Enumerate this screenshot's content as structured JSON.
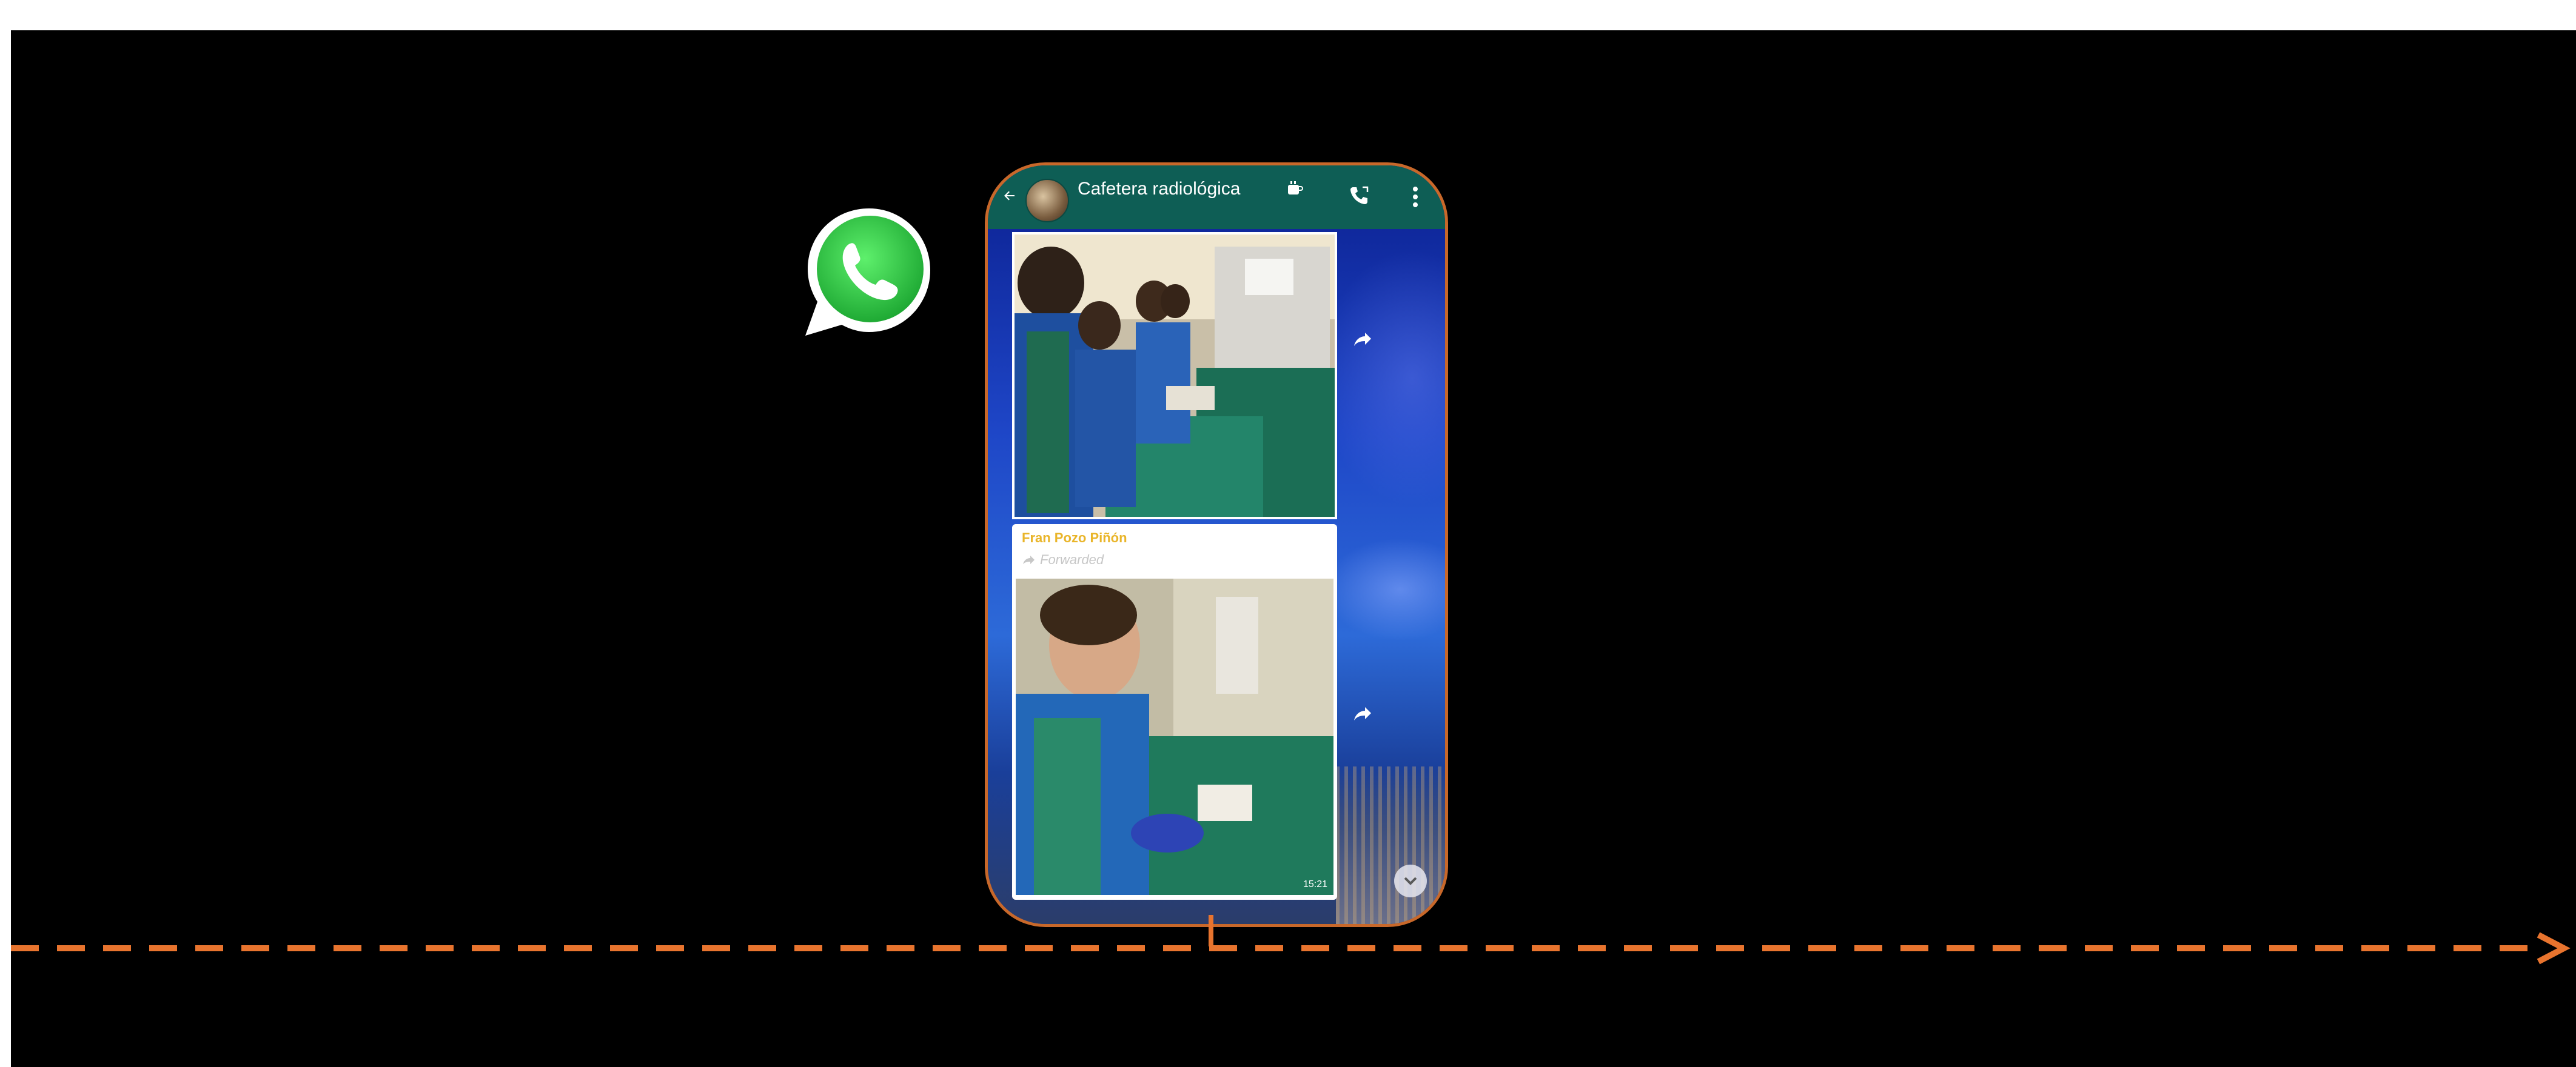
{
  "chat": {
    "title": "Cafetera radiológica",
    "messages": [
      {
        "type": "image",
        "description": "photo"
      },
      {
        "type": "forwarded-image",
        "sender": "Fran Pozo Piñón",
        "forwarded_label": "Forwarded",
        "time": "15:21"
      }
    ]
  },
  "icons": {
    "logo": "whatsapp-icon",
    "header_title_emoji": "coffee-icon",
    "call": "phone-call-icon",
    "menu": "more-vertical-icon",
    "share": "share-forward-icon"
  },
  "colors": {
    "background": "#000000",
    "timeline": "#e8742e",
    "phone_border": "#c8682a",
    "header": "#0e5e55",
    "sender_name": "#e9b52a",
    "whatsapp_green": "#2fd34b"
  }
}
